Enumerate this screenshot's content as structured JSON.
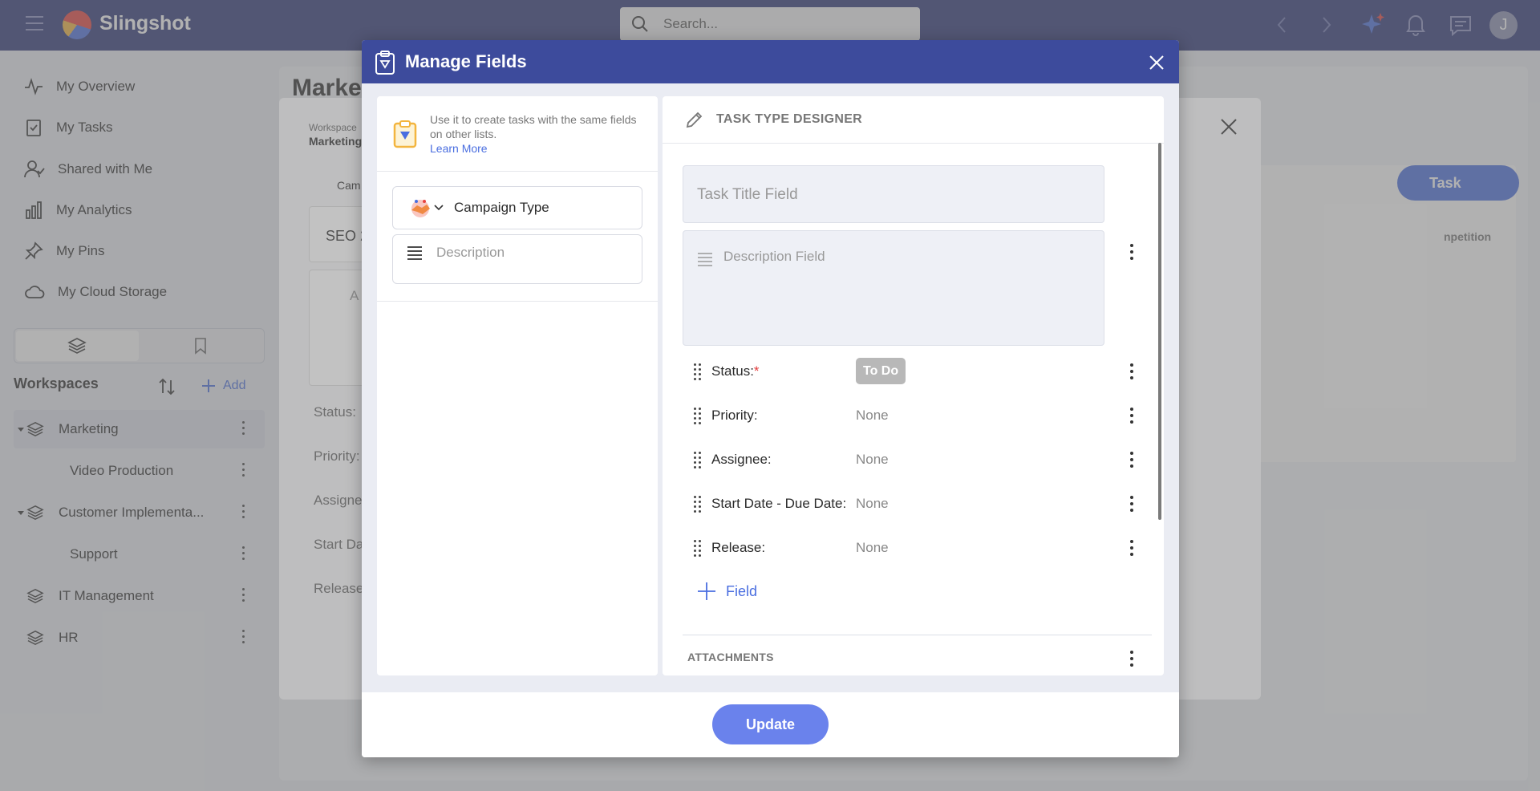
{
  "app": {
    "name": "Slingshot",
    "search_placeholder": "Search...",
    "avatar_initial": "J"
  },
  "sidebar": {
    "nav": [
      {
        "label": "My Overview",
        "icon": "pulse-icon"
      },
      {
        "label": "My Tasks",
        "icon": "tasks-icon"
      },
      {
        "label": "Shared with Me",
        "icon": "shared-user-icon"
      },
      {
        "label": "My Analytics",
        "icon": "analytics-icon"
      },
      {
        "label": "My Pins",
        "icon": "pin-icon"
      },
      {
        "label": "My Cloud Storage",
        "icon": "cloud-icon"
      }
    ],
    "workspaces_title": "Workspaces",
    "add_label": "Add",
    "workspaces": [
      {
        "label": "Marketing",
        "active": true
      },
      {
        "label": "Video Production",
        "child": true
      },
      {
        "label": "Customer Implementa...",
        "active": false
      },
      {
        "label": "Support",
        "child": true
      },
      {
        "label": "IT Management"
      },
      {
        "label": "HR"
      }
    ]
  },
  "background": {
    "page_title": "Marke",
    "breadcrumb_small": "Workspace",
    "breadcrumb_main": "Marketing",
    "campaign_short": "Cam",
    "task_short": "SEO 2",
    "desc_short": "A",
    "labels": [
      "Status:",
      "Priority:",
      "Assigne",
      "Start Da",
      "Release"
    ],
    "task_button": "Task",
    "col_header_short": "npetition"
  },
  "modal": {
    "title": "Manage Fields",
    "hint": "Use it to create tasks with the same fields on other lists.",
    "learn_more": "Learn More",
    "campaign_type": "Campaign Type",
    "description": "Description",
    "designer_title": "TASK TYPE DESIGNER",
    "task_title_field": "Task Title Field",
    "description_field": "Description Field",
    "properties": [
      {
        "name": "Status:",
        "required": true,
        "value": "To Do"
      },
      {
        "name": "Priority:",
        "value": "None"
      },
      {
        "name": "Assignee:",
        "value": "None"
      },
      {
        "name": "Start Date - Due Date:",
        "value": "None"
      },
      {
        "name": "Release:",
        "value": "None"
      }
    ],
    "add_field": "Field",
    "attachments": "ATTACHMENTS",
    "update_button": "Update"
  },
  "colors": {
    "topbar": "#2d3578",
    "modal_header": "#3d4b9c",
    "accent": "#4a6ee0",
    "update_button": "#6a82ec"
  }
}
